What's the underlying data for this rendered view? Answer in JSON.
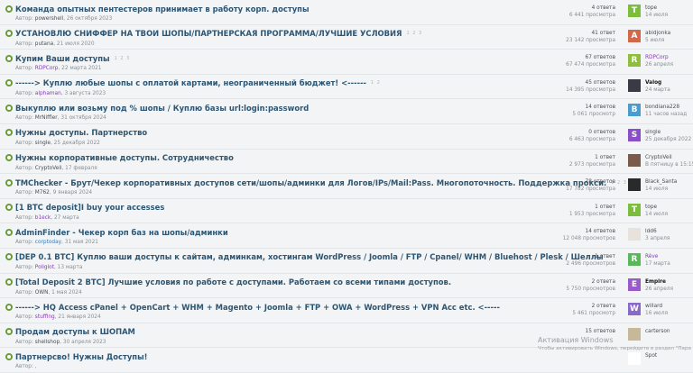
{
  "threads": [
    {
      "title": "Команда опытных пентестеров принимает в работу корп. доступы",
      "author_prefix": "Автор:",
      "author": "powershell",
      "author_style": "",
      "date": "26 октября 2023",
      "pages": "",
      "answers": "4 ответа",
      "views": "6 441 просмотра",
      "avatar_letter": "T",
      "avatar_color": "#7cbd3e",
      "last_user": "tope",
      "last_user_style": "",
      "last_date": "14 июля"
    },
    {
      "title": "УСТАНОВЛЮ СНИФФЕР НА ТВОИ ШОПЫ/ПАРТНЕРСКАЯ ПРОГРАММА/ЛУЧШИЕ УСЛОВИЯ",
      "author_prefix": "Автор:",
      "author": "putana",
      "author_style": "",
      "date": "21 июля 2020",
      "pages": "1 2 3",
      "answers": "41 ответ",
      "views": "23 142 просмотра",
      "avatar_letter": "A",
      "avatar_color": "#d2684a",
      "last_user": "abidjonka",
      "last_user_style": "",
      "last_date": "5 июля"
    },
    {
      "title": "Купим Ваши доступы",
      "author_prefix": "Автор:",
      "author": "RDPCorp",
      "author_style": "purple",
      "date": "22 марта 2021",
      "pages": "1 2 3",
      "answers": "67 ответов",
      "views": "67 474 просмотра",
      "avatar_letter": "R",
      "avatar_color": "#8fbe3a",
      "last_user": "RDPCorp",
      "last_user_style": "purple",
      "last_date": "26 апреля"
    },
    {
      "title": "------> Куплю любые шопы с оплатой картами, неограниченный бюджет! <------",
      "author_prefix": "Автор:",
      "author": "alphaman",
      "author_style": "purple",
      "date": "3 августа 2023",
      "pages": "1 2",
      "answers": "45 ответов",
      "views": "14 395 просмотра",
      "avatar_letter": "",
      "avatar_color": "#3a3a46",
      "last_user": "Valog",
      "last_user_style": "bold",
      "last_date": "24 марта"
    },
    {
      "title": "Выкуплю или возьму под % шопы / Куплю базы url:login:password",
      "author_prefix": "Автор:",
      "author": "MrNiffler",
      "author_style": "",
      "date": "31 октября 2024",
      "pages": "",
      "answers": "14 ответов",
      "views": "5 061 просмотр",
      "avatar_letter": "B",
      "avatar_color": "#4a9ccf",
      "last_user": "bondiana228",
      "last_user_style": "",
      "last_date": "11 часов назад"
    },
    {
      "title": "Нужны доступы. Партнерство",
      "author_prefix": "Автор:",
      "author": "single",
      "author_style": "",
      "date": "25 декабря 2022",
      "pages": "",
      "answers": "0 ответов",
      "views": "6 463 просмотра",
      "avatar_letter": "S",
      "avatar_color": "#8a4fc8",
      "last_user": "single",
      "last_user_style": "",
      "last_date": "25 декабря 2022"
    },
    {
      "title": "Нужны корпоративные доступы. Сотрудничество",
      "author_prefix": "Автор:",
      "author": "CryptoVeil",
      "author_style": "",
      "date": "17 февраля",
      "pages": "",
      "answers": "1 ответ",
      "views": "2 973 просмотра",
      "avatar_letter": "",
      "avatar_color": "#7a5a4a",
      "last_user": "CryptoVeil",
      "last_user_style": "",
      "last_date": "В пятницу в 15:15"
    },
    {
      "title": "TMChecker - Брут/Чекер корпоративных доступов сети/шопы/админки для Логов/IPs/Mail:Pass. Многопоточность. Поддержка прокси.",
      "author_prefix": "Автор:",
      "author": "M762",
      "author_style": "",
      "date": "9 января 2024",
      "pages": "1 2 3",
      "answers": "78 ответов",
      "views": "17 782 просмотра",
      "avatar_letter": "",
      "avatar_color": "#2a2a2a",
      "last_user": "Black_Santa",
      "last_user_style": "",
      "last_date": "14 июля"
    },
    {
      "title": "[1 BTC deposit]I buy your accesses",
      "author_prefix": "Автор:",
      "author": "b1eck",
      "author_style": "purple",
      "date": "27 марта",
      "pages": "",
      "answers": "1 ответ",
      "views": "1 953 просмотра",
      "avatar_letter": "T",
      "avatar_color": "#7cbd3e",
      "last_user": "tope",
      "last_user_style": "",
      "last_date": "14 июля"
    },
    {
      "title": "AdminFinder - Чекер корп баз на шопы/админки",
      "author_prefix": "Автор:",
      "author": "corptoday",
      "author_style": "blue",
      "date": "31 мая 2021",
      "pages": "",
      "answers": "14 ответов",
      "views": "12 048 просмотров",
      "avatar_letter": "",
      "avatar_color": "#e8e2dc",
      "last_user": "ldd6",
      "last_user_style": "",
      "last_date": "3 апреля"
    },
    {
      "title": "[DEP 0.1 BTC] Куплю ваши доступы к сайтам, админкам, хостингам WordPress / Joomla / FTP / Cpanel/ WHM / Bluehost / Plesk / Шеллы",
      "author_prefix": "Автор:",
      "author": "Poliglot",
      "author_style": "purple",
      "date": "13 марта",
      "pages": "",
      "answers": "1 ответ",
      "views": "2 496 просмотров",
      "avatar_letter": "R",
      "avatar_color": "#5ab85a",
      "last_user": "Rève",
      "last_user_style": "purple",
      "last_date": "17 марта"
    },
    {
      "title": "[Total Deposit 2 BTC] Лучшие условия по работе с доступами. Работаем со всеми типами доступов.",
      "author_prefix": "Автор:",
      "author": "OWN",
      "author_style": "",
      "date": "1 мая 2024",
      "pages": "",
      "answers": "2 ответа",
      "views": "5 750 просмотров",
      "avatar_letter": "E",
      "avatar_color": "#9a5ac8",
      "last_user": "Empire",
      "last_user_style": "bold",
      "last_date": "26 апреля"
    },
    {
      "title": "------> HQ Access cPanel + OpenCart + WHM + Magento + Joomla + FTP + OWA + WordPress + VPN Acc etc. <-----",
      "author_prefix": "Автор:",
      "author": "stuffing",
      "author_style": "purple",
      "date": "21 января 2024",
      "pages": "",
      "answers": "2 ответа",
      "views": "5 461 просмотр",
      "avatar_letter": "W",
      "avatar_color": "#8a6ac8",
      "last_user": "willard",
      "last_user_style": "",
      "last_date": "16 июля"
    },
    {
      "title": "Продам доступы к ШОПАМ",
      "author_prefix": "Автор:",
      "author": "shellshop",
      "author_style": "",
      "date": "30 апреля 2023",
      "pages": "",
      "answers": "15 ответов",
      "views": "",
      "avatar_letter": "",
      "avatar_color": "#c8b89a",
      "last_user": "carterson",
      "last_user_style": "",
      "last_date": ""
    },
    {
      "title": "Партнерсво! Нужны Доступы!",
      "author_prefix": "Автор:",
      "author": "",
      "author_style": "",
      "date": "",
      "pages": "",
      "answers": "",
      "views": "",
      "avatar_letter": "S",
      "avatar_color": "#ffffff",
      "last_user": "Spot",
      "last_user_style": "",
      "last_date": ""
    }
  ],
  "watermark": {
    "line1": "Активация Windows",
    "line2": "Чтобы активировать Windows, перейдите в раздел \"Пара"
  },
  "colors": {
    "title": "#2e5673",
    "pin": "#6b9c3a"
  },
  "icons": {
    "pin": "sticky-pin-icon"
  }
}
